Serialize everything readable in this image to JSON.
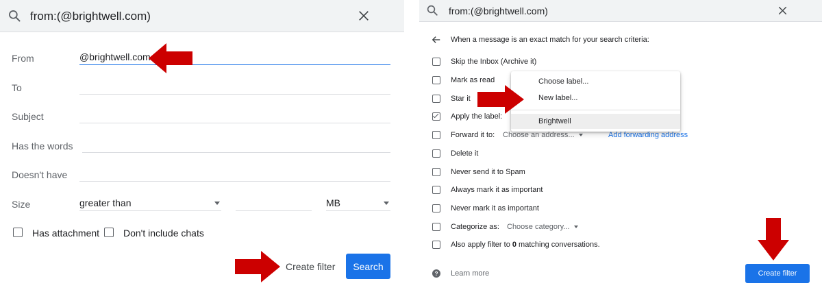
{
  "left": {
    "search_query": "from:(@brightwell.com)",
    "fields": {
      "from_label": "From",
      "from_value": "@brightwell.com",
      "to_label": "To",
      "subject_label": "Subject",
      "has_words_label": "Has the words",
      "doesnt_have_label": "Doesn't have",
      "size_label": "Size",
      "size_operator": "greater than",
      "size_unit": "MB"
    },
    "has_attachment": "Has attachment",
    "dont_include_chats": "Don't include chats",
    "create_filter": "Create filter",
    "search": "Search"
  },
  "right": {
    "search_query": "from:(@brightwell.com)",
    "heading": "When a message is an exact match for your search criteria:",
    "options": {
      "skip_inbox": "Skip the Inbox (Archive it)",
      "mark_read": "Mark as read",
      "star_it": "Star it",
      "apply_label": "Apply the label:",
      "forward_to": "Forward it to:",
      "forward_select": "Choose an address...",
      "add_forwarding": "Add forwarding address",
      "delete_it": "Delete it",
      "never_spam": "Never send it to Spam",
      "always_important": "Always mark it as important",
      "never_important": "Never mark it as important",
      "categorize": "Categorize as:",
      "category_select": "Choose category...",
      "also_apply_prefix": "Also apply filter to ",
      "also_apply_count": "0",
      "also_apply_suffix": " matching conversations."
    },
    "checked": {
      "apply_label": true
    },
    "menu": {
      "choose_label": "Choose label...",
      "new_label": "New label...",
      "brightwell": "Brightwell"
    },
    "learn_more": "Learn more",
    "create_filter": "Create filter"
  },
  "colors": {
    "accent": "#1a73e8",
    "arrow": "#cc0000",
    "searchbar_bg": "#f1f3f4"
  },
  "icons": [
    "search-icon",
    "close-icon",
    "back-arrow-icon",
    "help-icon",
    "red-arrow-icon"
  ]
}
